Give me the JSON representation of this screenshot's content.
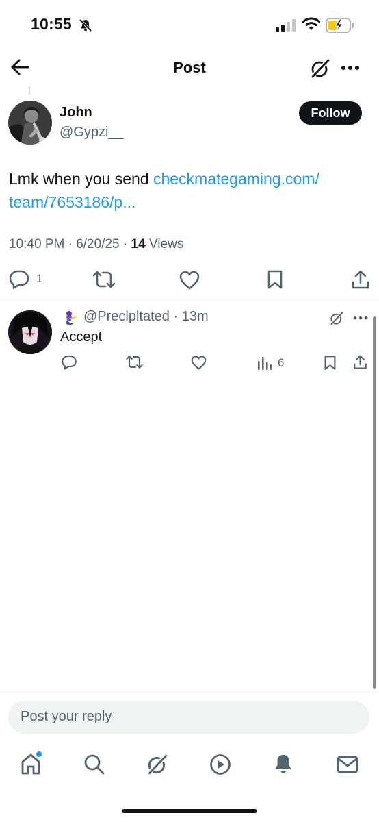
{
  "status_bar": {
    "time": "10:55"
  },
  "header": {
    "title": "Post"
  },
  "post": {
    "author_name": "John",
    "author_handle": "@Gypzi__",
    "follow_label": "Follow",
    "text_plain": "Lmk when you send ",
    "link_line1": "checkmategaming.com/",
    "link_line2": "team/7653186/p...",
    "timestamp": "10:40 PM · 6/20/25 · ",
    "views_count": "14",
    "views_label": " Views",
    "reply_count": "1"
  },
  "reply": {
    "handle": "@Preclpltated",
    "time": " · 13m",
    "text": "Accept",
    "views_count": "6"
  },
  "composer": {
    "placeholder": "Post your reply"
  },
  "colors": {
    "accent": "#1d9bf0",
    "text": "#0f1419",
    "secondary": "#536471"
  },
  "icons": [
    "back-arrow-icon",
    "grok-icon",
    "more-icon",
    "reply-icon",
    "repost-icon",
    "like-icon",
    "bookmark-icon",
    "share-icon",
    "views-icon",
    "home-icon",
    "search-icon",
    "play-icon",
    "bell-icon",
    "mail-icon"
  ]
}
